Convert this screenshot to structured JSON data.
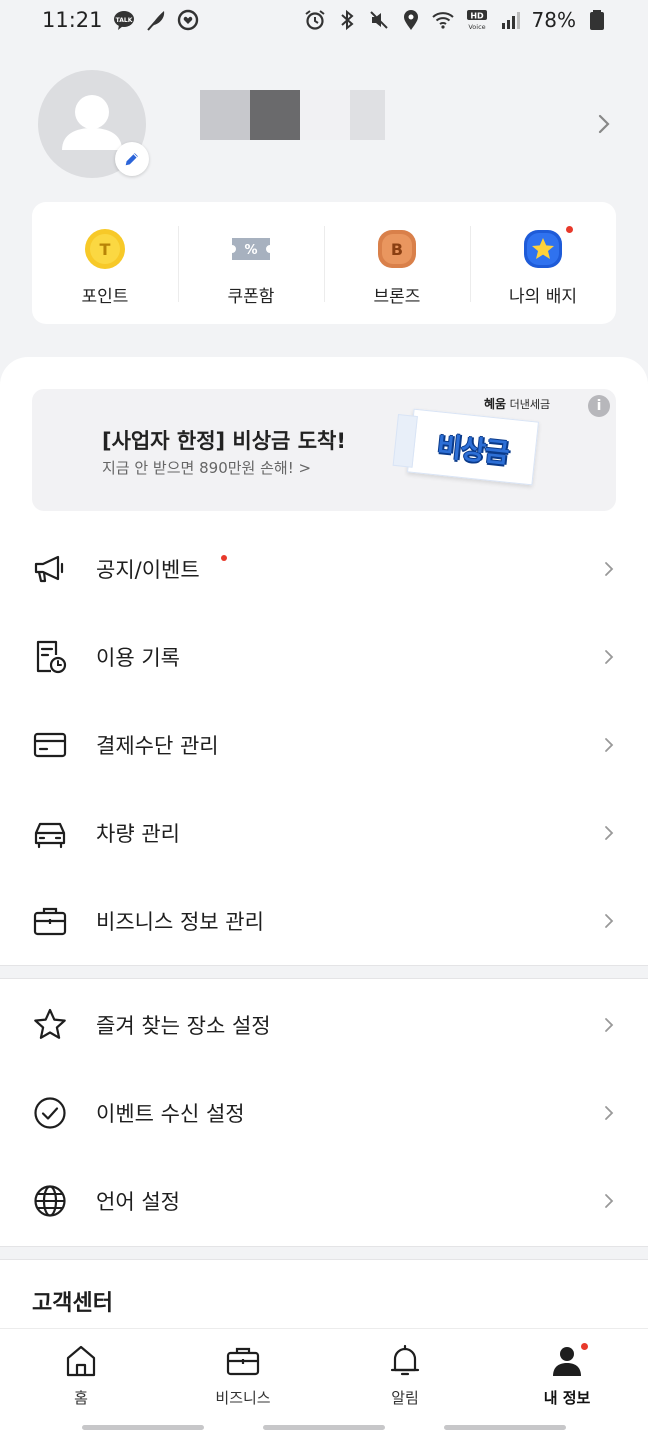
{
  "status_bar": {
    "time": "11:21",
    "battery": "78%",
    "left_icons": [
      "kakaotalk-icon",
      "feather-icon",
      "heart-circle-icon"
    ],
    "right_icons": [
      "alarm-icon",
      "bluetooth-icon",
      "mute-icon",
      "location-icon",
      "wifi-icon",
      "hd-voice-icon",
      "signal-icon",
      "battery-icon"
    ],
    "hd_label": "HD",
    "voice_label": "Voice"
  },
  "profile": {
    "name_blurred": true
  },
  "quick_menu": [
    {
      "label": "포인트",
      "icon": "point-coin-icon",
      "badge": "T",
      "dot": false
    },
    {
      "label": "쿠폰함",
      "icon": "coupon-ticket-icon",
      "badge": "%",
      "dot": false
    },
    {
      "label": "브론즈",
      "icon": "bronze-grade-icon",
      "badge": "B",
      "dot": false
    },
    {
      "label": "나의 배지",
      "icon": "star-badge-icon",
      "badge": "",
      "dot": true
    }
  ],
  "banner": {
    "title": "[사업자 한정] 비상금 도착!",
    "subtitle": "지금 안 받으면 890만원 손해! >",
    "brand_bold": "혜움",
    "brand_rest": " 더낸세금",
    "info": "i",
    "ticket_text": "비상금"
  },
  "menu_group_1": [
    {
      "label": "공지/이벤트",
      "icon": "megaphone-icon",
      "dot": true
    },
    {
      "label": "이용 기록",
      "icon": "history-document-icon",
      "dot": false
    },
    {
      "label": "결제수단 관리",
      "icon": "credit-card-icon",
      "dot": false
    },
    {
      "label": "차량 관리",
      "icon": "car-icon",
      "dot": false
    },
    {
      "label": "비즈니스 정보 관리",
      "icon": "briefcase-icon",
      "dot": false
    }
  ],
  "menu_group_2": [
    {
      "label": "즐겨 찾는 장소 설정",
      "icon": "star-outline-icon",
      "dot": false
    },
    {
      "label": "이벤트 수신 설정",
      "icon": "check-circle-icon",
      "dot": false
    },
    {
      "label": "언어 설정",
      "icon": "globe-icon",
      "dot": false
    }
  ],
  "support": {
    "title": "고객센터"
  },
  "bottom_nav": [
    {
      "label": "홈",
      "icon": "home-icon",
      "active": false,
      "dot": false
    },
    {
      "label": "비즈니스",
      "icon": "briefcase-icon",
      "active": false,
      "dot": false
    },
    {
      "label": "알림",
      "icon": "bell-icon",
      "active": false,
      "dot": false
    },
    {
      "label": "내 정보",
      "icon": "person-icon",
      "active": true,
      "dot": true
    }
  ],
  "colors": {
    "background": "#f2f3f5",
    "accent_red_dot": "#e8392b",
    "point_yellow": "#f7c928",
    "bronze": "#d9804a",
    "badge_blue": "#1e5bd8",
    "ticket_blue": "#2d6fd6"
  }
}
